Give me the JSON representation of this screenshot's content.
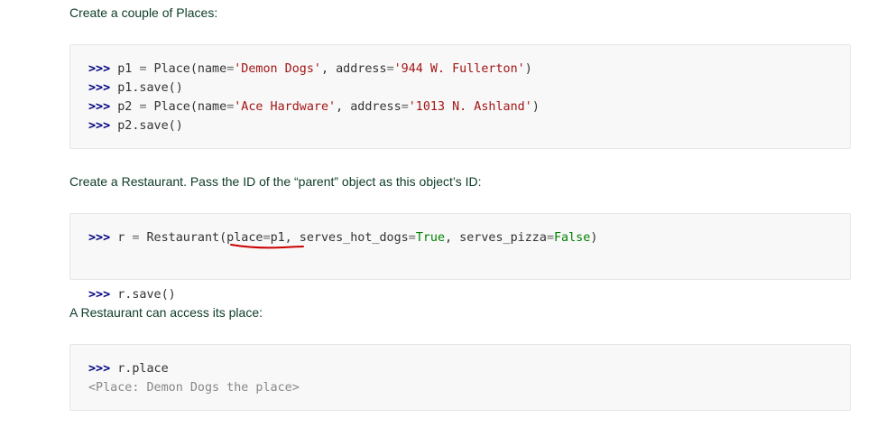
{
  "paragraphs": {
    "places": "Create a couple of Places:",
    "restaurant": "Create a Restaurant. Pass the ID of the “parent” object as this object’s ID:",
    "access": "A Restaurant can access its place:"
  },
  "prompt": ">>>",
  "block1": {
    "line1": {
      "a": "p1 ",
      "eq": "=",
      "b": " Place(name",
      "eq2": "=",
      "s1": "'Demon Dogs'",
      "c": ", address",
      "eq3": "=",
      "s2": "'944 W. Fullerton'",
      "d": ")"
    },
    "line2": "p1.save()",
    "line3": {
      "a": "p2 ",
      "eq": "=",
      "b": " Place(name",
      "eq2": "=",
      "s1": "'Ace Hardware'",
      "c": ", address",
      "eq3": "=",
      "s2": "'1013 N. Ashland'",
      "d": ")"
    },
    "line4": "p2.save()"
  },
  "block2": {
    "line1": {
      "a": "r ",
      "eq": "=",
      "b": " Restaurant(place",
      "eq2": "=",
      "c": "p1, serves_hot_dogs",
      "eq3": "=",
      "t": "True",
      "d": ", serves_pizza",
      "eq4": "=",
      "f": "False",
      "e": ")"
    },
    "line2": "r.save()"
  },
  "block3": {
    "line1": "r.place",
    "output": "<Place: Demon Dogs the place>"
  },
  "annotation_color": "#cc0000"
}
